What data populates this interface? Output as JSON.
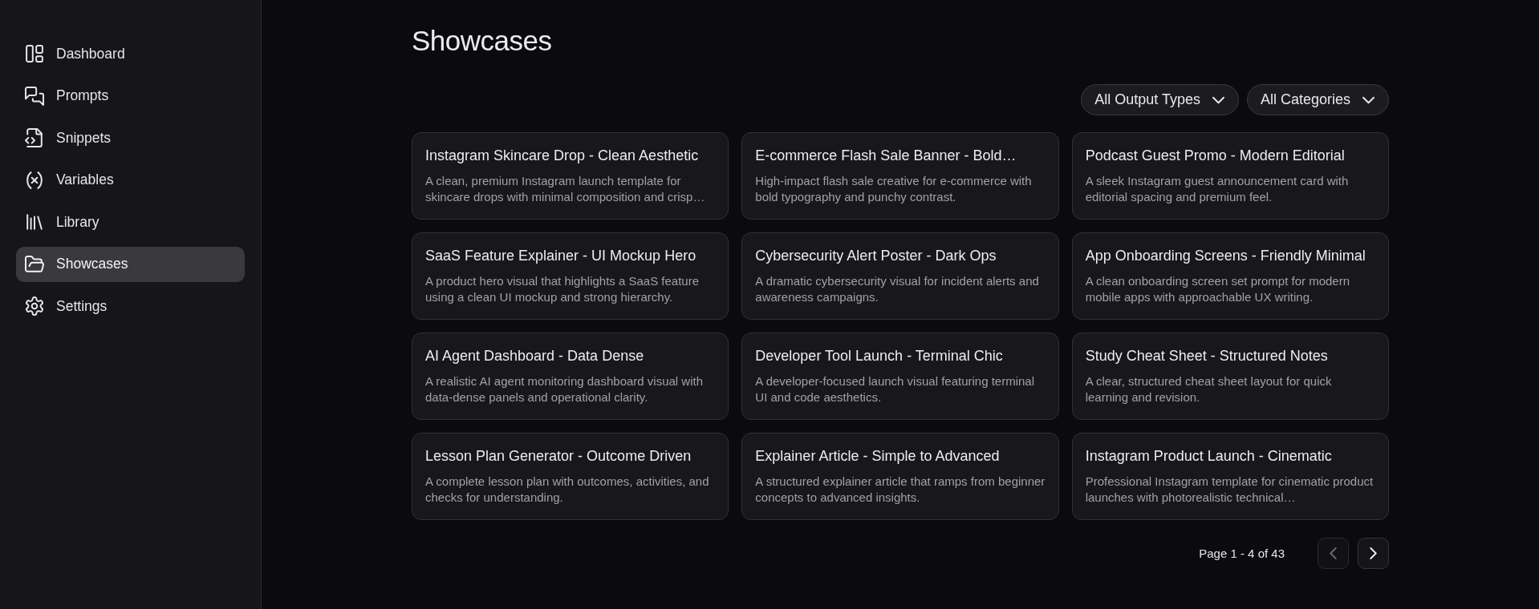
{
  "sidebar": {
    "items": [
      {
        "label": "Dashboard",
        "selected": false
      },
      {
        "label": "Prompts",
        "selected": false
      },
      {
        "label": "Snippets",
        "selected": false
      },
      {
        "label": "Variables",
        "selected": false
      },
      {
        "label": "Library",
        "selected": false
      },
      {
        "label": "Showcases",
        "selected": true
      },
      {
        "label": "Settings",
        "selected": false
      }
    ]
  },
  "page": {
    "title": "Showcases"
  },
  "filters": [
    {
      "label": "All Output Types"
    },
    {
      "label": "All Categories"
    }
  ],
  "showcases": [
    {
      "title": "Instagram Skincare Drop - Clean Aesthetic",
      "description": "A clean, premium Instagram launch template for skincare drops with minimal composition and crisp…"
    },
    {
      "title": "E-commerce Flash Sale Banner - Bold…",
      "description": "High-impact flash sale creative for e-commerce with bold typography and punchy contrast."
    },
    {
      "title": "Podcast Guest Promo - Modern Editorial",
      "description": "A sleek Instagram guest announcement card with editorial spacing and premium feel."
    },
    {
      "title": "SaaS Feature Explainer - UI Mockup Hero",
      "description": "A product hero visual that highlights a SaaS feature using a clean UI mockup and strong hierarchy."
    },
    {
      "title": "Cybersecurity Alert Poster - Dark Ops",
      "description": "A dramatic cybersecurity visual for incident alerts and awareness campaigns."
    },
    {
      "title": "App Onboarding Screens - Friendly Minimal",
      "description": "A clean onboarding screen set prompt for modern mobile apps with approachable UX writing."
    },
    {
      "title": "AI Agent Dashboard - Data Dense",
      "description": "A realistic AI agent monitoring dashboard visual with data-dense panels and operational clarity."
    },
    {
      "title": "Developer Tool Launch - Terminal Chic",
      "description": "A developer-focused launch visual featuring terminal UI and code aesthetics."
    },
    {
      "title": "Study Cheat Sheet - Structured Notes",
      "description": "A clear, structured cheat sheet layout for quick learning and revision."
    },
    {
      "title": "Lesson Plan Generator - Outcome Driven",
      "description": "A complete lesson plan with outcomes, activities, and checks for understanding."
    },
    {
      "title": "Explainer Article - Simple to Advanced",
      "description": "A structured explainer article that ramps from beginner concepts to advanced insights."
    },
    {
      "title": "Instagram Product Launch - Cinematic",
      "description": "Professional Instagram template for cinematic product launches with photorealistic technical…"
    }
  ],
  "pagination": {
    "summary": "Page 1 - 4 of 43",
    "buttons": [
      {
        "kind": "previous",
        "disabled": true
      },
      {
        "kind": "next",
        "disabled": false
      }
    ]
  }
}
